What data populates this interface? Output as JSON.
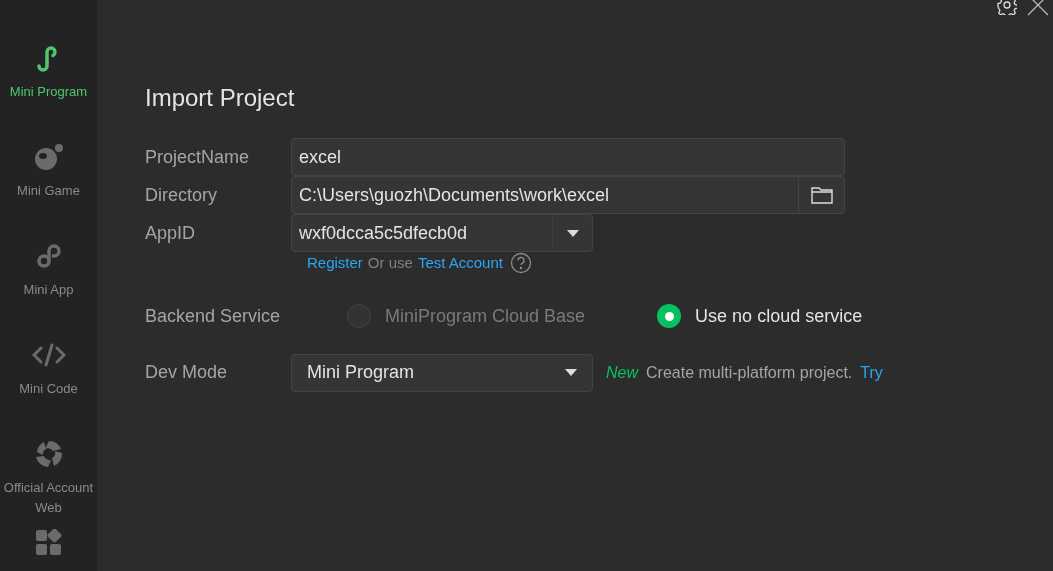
{
  "sidebar": {
    "items": [
      {
        "label": "Mini Program",
        "selected": true
      },
      {
        "label": "Mini Game",
        "selected": false
      },
      {
        "label": "Mini App",
        "selected": false
      },
      {
        "label": "Mini Code",
        "selected": false
      },
      {
        "label": "Official Account Web",
        "selected": false
      }
    ]
  },
  "title": "Import Project",
  "project_name": {
    "label": "ProjectName",
    "value": "excel"
  },
  "directory": {
    "label": "Directory",
    "value": "C:\\Users\\guozh\\Documents\\work\\excel"
  },
  "appid": {
    "label": "AppID",
    "value": "wxf0dcca5c5dfecb0d",
    "register_link": "Register",
    "or_text": "Or use",
    "test_link": "Test Account"
  },
  "backend": {
    "label": "Backend Service",
    "options": [
      {
        "label": "MiniProgram Cloud Base",
        "selected": false,
        "disabled": true
      },
      {
        "label": "Use no cloud service",
        "selected": true,
        "disabled": false
      }
    ]
  },
  "dev_mode": {
    "label": "Dev Mode",
    "value": "Mini Program",
    "badge": "New",
    "hint": "Create multi-platform project.",
    "link": "Try"
  }
}
